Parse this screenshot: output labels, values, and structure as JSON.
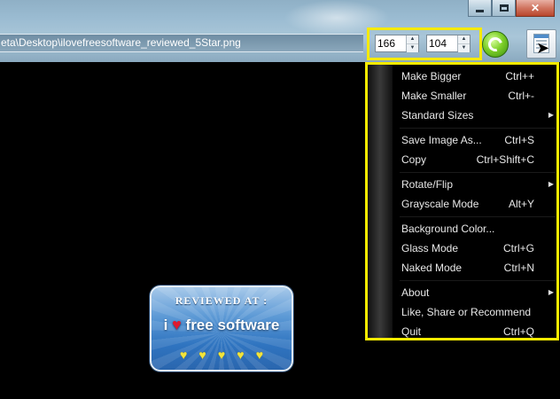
{
  "window": {
    "path": "eta\\Desktop\\ilovefreesoftware_reviewed_5Star.png",
    "caption_buttons": {
      "minimize": "—",
      "maximize": "□",
      "close": "✕"
    }
  },
  "toolbar": {
    "width_value": "166",
    "height_value": "104",
    "refresh_icon": "refresh-icon",
    "menu_icon": "menu-page-icon",
    "highlight_color": "#f5ea00"
  },
  "menu": {
    "items": [
      {
        "label": "Make Bigger",
        "shortcut": "Ctrl++",
        "submenu": false
      },
      {
        "label": "Make Smaller",
        "shortcut": "Ctrl+-",
        "submenu": false
      },
      {
        "label": "Standard Sizes",
        "shortcut": "",
        "submenu": true
      },
      {
        "label": "Save Image As...",
        "shortcut": "Ctrl+S",
        "submenu": false
      },
      {
        "label": "Copy",
        "shortcut": "Ctrl+Shift+C",
        "submenu": false
      },
      {
        "label": "Rotate/Flip",
        "shortcut": "",
        "submenu": true
      },
      {
        "label": "Grayscale Mode",
        "shortcut": "Alt+Y",
        "submenu": false
      },
      {
        "label": "Background Color...",
        "shortcut": "",
        "submenu": false
      },
      {
        "label": "Glass Mode",
        "shortcut": "Ctrl+G",
        "submenu": false
      },
      {
        "label": "Naked Mode",
        "shortcut": "Ctrl+N",
        "submenu": false
      },
      {
        "label": "About",
        "shortcut": "",
        "submenu": true
      },
      {
        "label": "Like, Share or Recommend",
        "shortcut": "",
        "submenu": false
      },
      {
        "label": "Quit",
        "shortcut": "Ctrl+Q",
        "submenu": false
      }
    ],
    "submenu_arrow": "▶"
  },
  "image": {
    "title": "REVIEWED AT :",
    "brand_prefix": "i",
    "heart": "♥",
    "brand_suffix": "free software",
    "stars": [
      "♥",
      "♥",
      "♥",
      "♥",
      "♥"
    ]
  }
}
